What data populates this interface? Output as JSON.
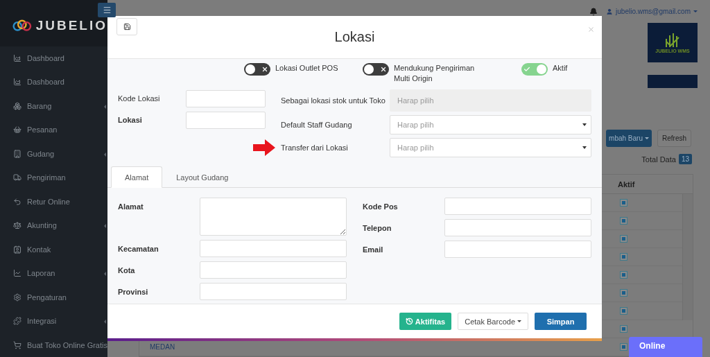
{
  "sidebar": {
    "brand": "JUBELIO",
    "items": [
      {
        "label": "Dashboard",
        "has_submenu": false
      },
      {
        "label": "Dashboard",
        "has_submenu": false
      },
      {
        "label": "Barang",
        "has_submenu": true
      },
      {
        "label": "Pesanan",
        "has_submenu": false
      },
      {
        "label": "Gudang",
        "has_submenu": true
      },
      {
        "label": "Pengiriman",
        "has_submenu": false
      },
      {
        "label": "Retur Online",
        "has_submenu": false
      },
      {
        "label": "Akunting",
        "has_submenu": true
      },
      {
        "label": "Kontak",
        "has_submenu": false
      },
      {
        "label": "Laporan",
        "has_submenu": true
      },
      {
        "label": "Pengaturan",
        "has_submenu": false
      },
      {
        "label": "Integrasi",
        "has_submenu": true
      },
      {
        "label": "Buat Toko Online Gratis",
        "has_submenu": false
      }
    ]
  },
  "header": {
    "user_email": "jubelio.wms@gmail.com",
    "logo_text": "JUBELIO WMS"
  },
  "page": {
    "buttons": [
      {
        "label": "mbah Baru",
        "kind": "primary"
      },
      {
        "label": "Refresh",
        "kind": "default"
      }
    ],
    "total_label": "Total Data",
    "total_count": "13",
    "table": {
      "column": "Aktif",
      "rows": [
        {
          "checked": true
        },
        {
          "checked": true
        },
        {
          "checked": true
        },
        {
          "checked": true
        },
        {
          "checked": true
        },
        {
          "checked": true
        },
        {
          "checked": true
        },
        {
          "checked": true
        },
        {
          "name": "MEDAN",
          "checked": true
        }
      ]
    }
  },
  "modal": {
    "title": "Lokasi",
    "toggles": [
      {
        "label": "Lokasi Outlet POS",
        "on": false
      },
      {
        "label": "Mendukung Pengiriman Multi Origin",
        "on": false
      },
      {
        "label": "Aktif",
        "on": true
      }
    ],
    "left_fields": [
      {
        "label": "Kode Lokasi",
        "required": false
      },
      {
        "label": "Lokasi",
        "required": true
      }
    ],
    "right_fields": [
      {
        "label": "Sebagai lokasi stok untuk Toko",
        "placeholder": "Harap pilih",
        "disabled": true,
        "pointed": false
      },
      {
        "label": "Default Staff Gudang",
        "placeholder": "Harap pilih",
        "disabled": false,
        "pointed": false
      },
      {
        "label": "Transfer dari Lokasi",
        "placeholder": "Harap pilih",
        "disabled": false,
        "pointed": true
      }
    ],
    "tabs": [
      {
        "label": "Alamat",
        "selected": true
      },
      {
        "label": "Layout Gudang",
        "selected": false
      }
    ],
    "address_left": [
      {
        "label": "Alamat",
        "kind": "textarea"
      },
      {
        "label": "Kecamatan",
        "kind": "input"
      },
      {
        "label": "Kota",
        "kind": "input"
      },
      {
        "label": "Provinsi",
        "kind": "input"
      }
    ],
    "address_right": [
      {
        "label": "Kode Pos",
        "kind": "input"
      },
      {
        "label": "Telepon",
        "kind": "input"
      },
      {
        "label": "Email",
        "kind": "input"
      }
    ],
    "footer_buttons": [
      {
        "label": "Aktifitas",
        "kind": "success"
      },
      {
        "label": "Cetak Barcode",
        "kind": "dropdown"
      },
      {
        "label": "Simpan",
        "kind": "primary"
      }
    ]
  },
  "chat": {
    "label": "Online"
  }
}
